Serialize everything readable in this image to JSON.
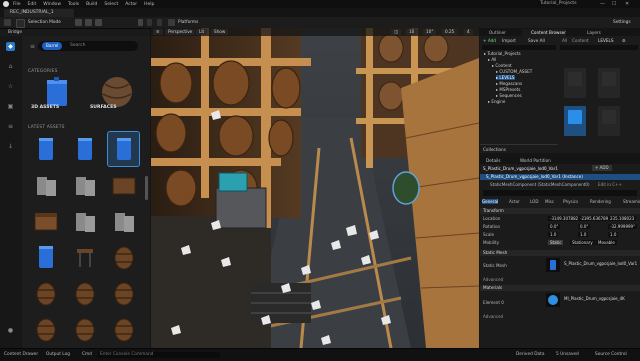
{
  "menubar": {
    "items": [
      "File",
      "Edit",
      "Window",
      "Tools",
      "Build",
      "Select",
      "Actor",
      "Help"
    ],
    "project": "Tutorial_Projects",
    "window_controls": [
      "—",
      "☐",
      "✕"
    ]
  },
  "tab": {
    "label": "REC_INDUSTRIAL_1"
  },
  "toolbar": {
    "mode": "Selection Mode",
    "platforms": "Platforms",
    "settings": "Settings"
  },
  "bridge": {
    "title": "Bridge",
    "search_chip": "Barrel",
    "search_placeholder": "Search",
    "categories_label": "CATEGORIES",
    "cat1": "3D ASSETS",
    "cat2": "SURFACES",
    "latest_label": "LATEST ASSETS"
  },
  "viewport": {
    "perspective": "Perspective",
    "lit": "Lit",
    "show": "Show"
  },
  "outliner": {
    "tabs": [
      "Outliner",
      "Content Browser",
      "Layers"
    ],
    "add": "+ Add",
    "import": "Import",
    "save_all": "Save All",
    "path": [
      "All",
      "Content",
      "LEVELS"
    ],
    "tree": [
      "Tutorial_Projects",
      "All",
      "Content",
      "CUSTOM_ASSET",
      "LEVELS",
      "Megascans",
      "MSPresets",
      "Sequences",
      "Engine"
    ],
    "collections": "Collections",
    "count": "15 items (1 selected)"
  },
  "details": {
    "tabs": [
      "Details",
      "World Partition"
    ],
    "actor": "S_Plastic_Drum_vgpcsjaie_lod0_Var1",
    "add": "+ ADD",
    "instance": "S_Plastic_Drum_vgpcsjaie_lod0_Var1 (Instance)",
    "component": "StaticMeshComponent (StaticMeshComponent0)",
    "edit": "Edit in C++",
    "filter_tabs": [
      "General",
      "Actor",
      "LOD",
      "Misc",
      "Physics",
      "Rendering",
      "Streaming"
    ],
    "transform": "Transform",
    "location_label": "Location",
    "location": [
      "-3149.307882",
      "-2395.636789",
      "235.108023"
    ],
    "rotation_label": "Rotation",
    "rotation": [
      "0.0°",
      "0.0°",
      "-32.999999°"
    ],
    "scale_label": "Scale",
    "scale": [
      "1.0",
      "1.0",
      "1.0"
    ],
    "mobility_label": "Mobility",
    "mobility": [
      "Static",
      "Stationary",
      "Movable"
    ],
    "static_mesh_section": "Static Mesh",
    "static_mesh_label": "Static Mesh",
    "static_mesh_value": "S_Plastic_Drum_vgpcsjaie_lod0_Var1",
    "advanced": "Advanced",
    "materials_section": "Materials",
    "element_label": "Element 0",
    "material_value": "MI_Plastic_Drum_vgpcsjaie_4K"
  },
  "status": {
    "content_drawer": "Content Drawer",
    "output_log": "Output Log",
    "cmd": "Cmd",
    "console_placeholder": "Enter Console Command",
    "derived": "Derived Data",
    "unsaved": "5 Unsaved",
    "source": "Source Control"
  },
  "colors": {
    "accent": "#2f7fd8",
    "play_green": "#35c435",
    "selection_blue": "#1f4f80",
    "wood": "#8a5a30"
  }
}
